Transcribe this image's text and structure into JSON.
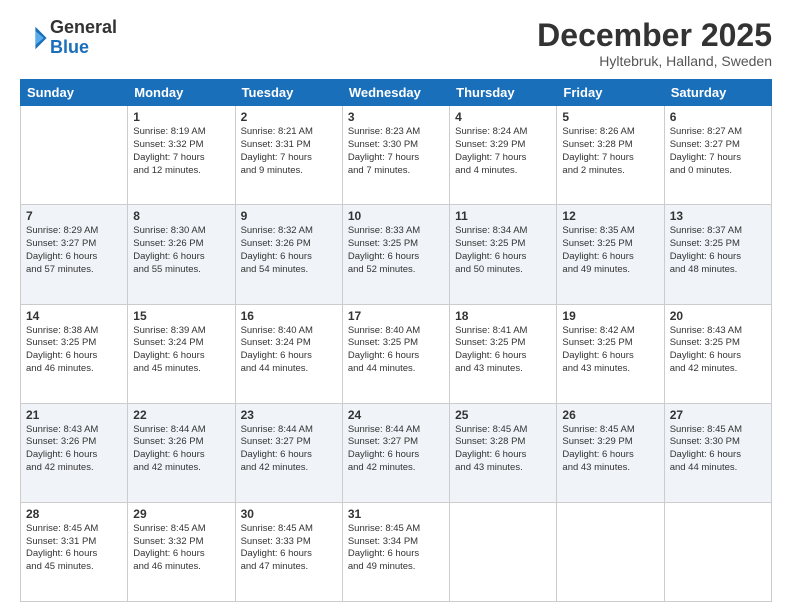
{
  "logo": {
    "general": "General",
    "blue": "Blue"
  },
  "title": {
    "month": "December 2025",
    "location": "Hyltebruk, Halland, Sweden"
  },
  "days_of_week": [
    "Sunday",
    "Monday",
    "Tuesday",
    "Wednesday",
    "Thursday",
    "Friday",
    "Saturday"
  ],
  "weeks": [
    [
      {
        "day": "",
        "info": ""
      },
      {
        "day": "1",
        "info": "Sunrise: 8:19 AM\nSunset: 3:32 PM\nDaylight: 7 hours\nand 12 minutes."
      },
      {
        "day": "2",
        "info": "Sunrise: 8:21 AM\nSunset: 3:31 PM\nDaylight: 7 hours\nand 9 minutes."
      },
      {
        "day": "3",
        "info": "Sunrise: 8:23 AM\nSunset: 3:30 PM\nDaylight: 7 hours\nand 7 minutes."
      },
      {
        "day": "4",
        "info": "Sunrise: 8:24 AM\nSunset: 3:29 PM\nDaylight: 7 hours\nand 4 minutes."
      },
      {
        "day": "5",
        "info": "Sunrise: 8:26 AM\nSunset: 3:28 PM\nDaylight: 7 hours\nand 2 minutes."
      },
      {
        "day": "6",
        "info": "Sunrise: 8:27 AM\nSunset: 3:27 PM\nDaylight: 7 hours\nand 0 minutes."
      }
    ],
    [
      {
        "day": "7",
        "info": "Sunrise: 8:29 AM\nSunset: 3:27 PM\nDaylight: 6 hours\nand 57 minutes."
      },
      {
        "day": "8",
        "info": "Sunrise: 8:30 AM\nSunset: 3:26 PM\nDaylight: 6 hours\nand 55 minutes."
      },
      {
        "day": "9",
        "info": "Sunrise: 8:32 AM\nSunset: 3:26 PM\nDaylight: 6 hours\nand 54 minutes."
      },
      {
        "day": "10",
        "info": "Sunrise: 8:33 AM\nSunset: 3:25 PM\nDaylight: 6 hours\nand 52 minutes."
      },
      {
        "day": "11",
        "info": "Sunrise: 8:34 AM\nSunset: 3:25 PM\nDaylight: 6 hours\nand 50 minutes."
      },
      {
        "day": "12",
        "info": "Sunrise: 8:35 AM\nSunset: 3:25 PM\nDaylight: 6 hours\nand 49 minutes."
      },
      {
        "day": "13",
        "info": "Sunrise: 8:37 AM\nSunset: 3:25 PM\nDaylight: 6 hours\nand 48 minutes."
      }
    ],
    [
      {
        "day": "14",
        "info": "Sunrise: 8:38 AM\nSunset: 3:25 PM\nDaylight: 6 hours\nand 46 minutes."
      },
      {
        "day": "15",
        "info": "Sunrise: 8:39 AM\nSunset: 3:24 PM\nDaylight: 6 hours\nand 45 minutes."
      },
      {
        "day": "16",
        "info": "Sunrise: 8:40 AM\nSunset: 3:24 PM\nDaylight: 6 hours\nand 44 minutes."
      },
      {
        "day": "17",
        "info": "Sunrise: 8:40 AM\nSunset: 3:25 PM\nDaylight: 6 hours\nand 44 minutes."
      },
      {
        "day": "18",
        "info": "Sunrise: 8:41 AM\nSunset: 3:25 PM\nDaylight: 6 hours\nand 43 minutes."
      },
      {
        "day": "19",
        "info": "Sunrise: 8:42 AM\nSunset: 3:25 PM\nDaylight: 6 hours\nand 43 minutes."
      },
      {
        "day": "20",
        "info": "Sunrise: 8:43 AM\nSunset: 3:25 PM\nDaylight: 6 hours\nand 42 minutes."
      }
    ],
    [
      {
        "day": "21",
        "info": "Sunrise: 8:43 AM\nSunset: 3:26 PM\nDaylight: 6 hours\nand 42 minutes."
      },
      {
        "day": "22",
        "info": "Sunrise: 8:44 AM\nSunset: 3:26 PM\nDaylight: 6 hours\nand 42 minutes."
      },
      {
        "day": "23",
        "info": "Sunrise: 8:44 AM\nSunset: 3:27 PM\nDaylight: 6 hours\nand 42 minutes."
      },
      {
        "day": "24",
        "info": "Sunrise: 8:44 AM\nSunset: 3:27 PM\nDaylight: 6 hours\nand 42 minutes."
      },
      {
        "day": "25",
        "info": "Sunrise: 8:45 AM\nSunset: 3:28 PM\nDaylight: 6 hours\nand 43 minutes."
      },
      {
        "day": "26",
        "info": "Sunrise: 8:45 AM\nSunset: 3:29 PM\nDaylight: 6 hours\nand 43 minutes."
      },
      {
        "day": "27",
        "info": "Sunrise: 8:45 AM\nSunset: 3:30 PM\nDaylight: 6 hours\nand 44 minutes."
      }
    ],
    [
      {
        "day": "28",
        "info": "Sunrise: 8:45 AM\nSunset: 3:31 PM\nDaylight: 6 hours\nand 45 minutes."
      },
      {
        "day": "29",
        "info": "Sunrise: 8:45 AM\nSunset: 3:32 PM\nDaylight: 6 hours\nand 46 minutes."
      },
      {
        "day": "30",
        "info": "Sunrise: 8:45 AM\nSunset: 3:33 PM\nDaylight: 6 hours\nand 47 minutes."
      },
      {
        "day": "31",
        "info": "Sunrise: 8:45 AM\nSunset: 3:34 PM\nDaylight: 6 hours\nand 49 minutes."
      },
      {
        "day": "",
        "info": ""
      },
      {
        "day": "",
        "info": ""
      },
      {
        "day": "",
        "info": ""
      }
    ]
  ]
}
